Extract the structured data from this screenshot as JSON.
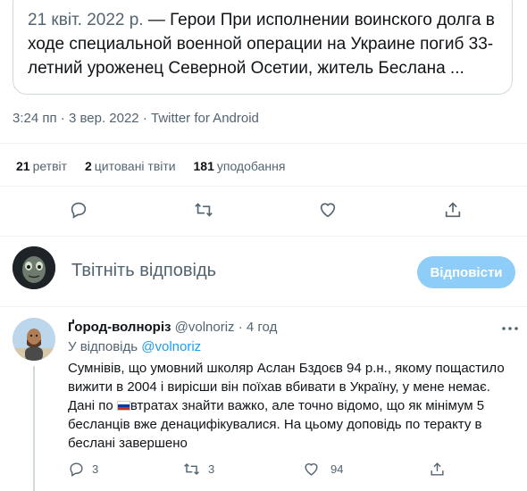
{
  "quoted_card": {
    "date": "21 квіт. 2022 р.",
    "text_rest": " — Герои При исполнении воинского долга в ходе специальной военной операции на Украине погиб 33-летний уроженец Северной Осетии, житель Беслана ..."
  },
  "meta": {
    "time": "3:24 пп",
    "sep1": " · ",
    "date": "3 вер. 2022",
    "sep2": " · ",
    "source": "Twitter for Android"
  },
  "stats": {
    "retweets_num": "21",
    "retweets_label": "ретвіт",
    "quotes_num": "2",
    "quotes_label": "цитовані твіти",
    "likes_num": "181",
    "likes_label": "уподобання"
  },
  "actions": {
    "icons": [
      "reply-icon",
      "retweet-icon",
      "like-icon",
      "share-icon"
    ]
  },
  "reply_box": {
    "prompt": "Твітніть відповідь",
    "button": "Відповісти"
  },
  "reply": {
    "name": "Ґород-волноріз",
    "handle": "@volnoriz",
    "dot": " · ",
    "time": "4 год",
    "replying_label": "У відповідь ",
    "replying_handle": "@volnoriz",
    "text_part1": "Сумнівів, що умовний школяр Аслан Бздоєв 94 р.н., якому пощастило вижити в 2004 і вирісши він поїхав вбивати в Україну, у мене немає. Дані по ",
    "text_part2": "втратах знайти важко, але точно відомо, що як мінімум 5 бесланців вже денацифікувалися. На цьому доповідь по теракту в беслані завершено",
    "reply_count": "3",
    "retweet_count": "3",
    "like_count": "94"
  },
  "colors": {
    "accent": "#1d9bf0",
    "button_disabled": "#8ecdf8",
    "secondary_text": "#536471",
    "border": "#cfd9de"
  }
}
